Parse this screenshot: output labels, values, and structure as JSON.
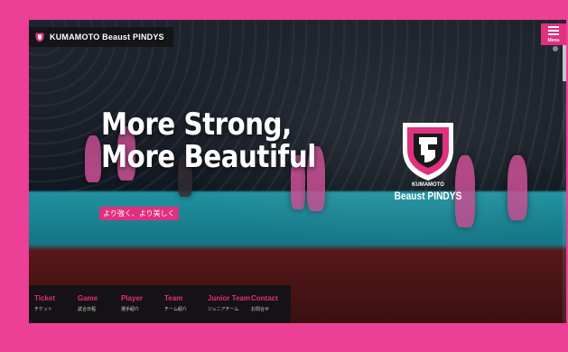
{
  "brand": {
    "name": "KUMAMOTO Beaust PINDYS"
  },
  "menu": {
    "label": "Menu"
  },
  "hero": {
    "headline_line1": "More Strong,",
    "headline_line2": "More Beautiful",
    "tagline": "より強く、より美しく"
  },
  "emblem": {
    "city": "KUMAMOTO",
    "team": "Beaust PINDYS"
  },
  "nav": {
    "items": [
      {
        "en": "Ticket",
        "ja": "チケット"
      },
      {
        "en": "Game",
        "ja": "試合日程"
      },
      {
        "en": "Player",
        "ja": "選手紹介"
      },
      {
        "en": "Team",
        "ja": "チーム紹介"
      },
      {
        "en": "Junior Team",
        "ja": "ジュニアチーム"
      },
      {
        "en": "Contact",
        "ja": "お問合せ"
      }
    ]
  },
  "colors": {
    "accent": "#e0307e",
    "frame": "#ec3f96",
    "nav_bg": "#121216"
  }
}
